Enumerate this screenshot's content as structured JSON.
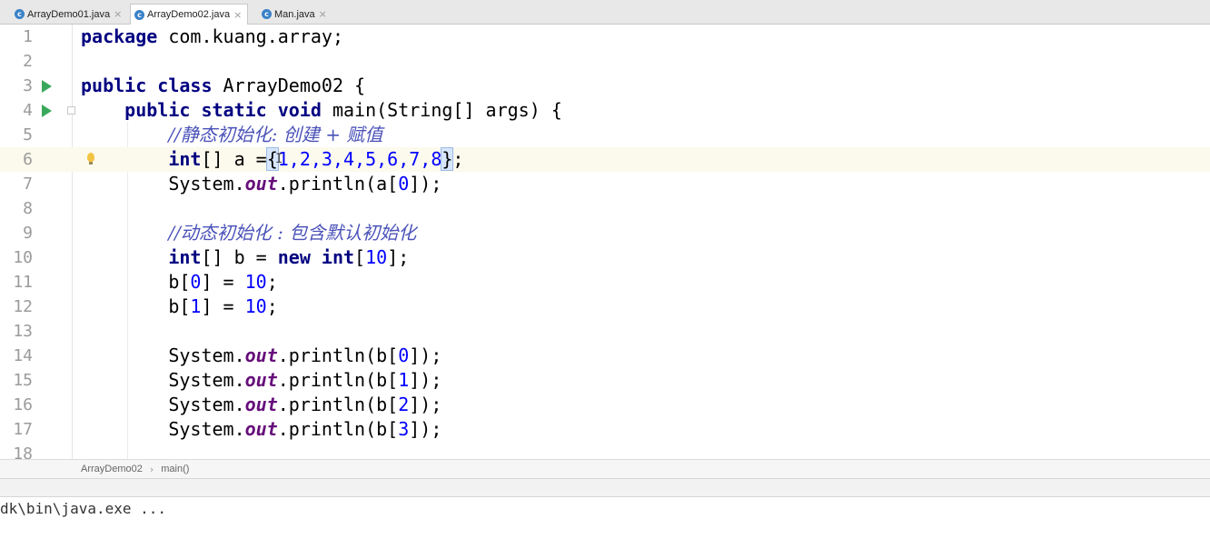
{
  "tabs": [
    {
      "label": "ArrayDemo01.java",
      "icon": "java-class-icon",
      "active": false
    },
    {
      "label": "ArrayDemo02.java",
      "icon": "java-class-icon",
      "active": true
    },
    {
      "label": "Man.java",
      "icon": "java-class-icon",
      "active": false
    }
  ],
  "editor": {
    "line_numbers": [
      "1",
      "2",
      "3",
      "4",
      "5",
      "6",
      "7",
      "8",
      "9",
      "10",
      "11",
      "12",
      "13",
      "14",
      "15",
      "16",
      "17",
      "18"
    ],
    "caret_line": "6",
    "code": {
      "l1_kw": "package",
      "l1_rest": " com.kuang.array;",
      "l3_kw1": "public",
      "l3_kw2": "class",
      "l3_rest": " ArrayDemo02 {",
      "l4_kw1": "public",
      "l4_kw2": "static",
      "l4_kw3": "void",
      "l4_rest": " main(String[] args) {",
      "l5_comment": "//静态初始化: 创建 + 赋值",
      "l6_kw": "int",
      "l6_a": "[] a =",
      "l6_open": "{",
      "l6_values": "1,2,3,4,5,6,7,8",
      "l6_close": "}",
      "l6_end": ";",
      "l7_sys": "System.",
      "l7_out": "out",
      "l7_rest": ".println(a[",
      "l7_idx": "0",
      "l7_end": "]);",
      "l9_comment": "//动态初始化 : 包含默认初始化",
      "l10_kw": "int",
      "l10_a": "[] b = ",
      "l10_new": "new",
      "l10_sp": " ",
      "l10_kw2": "int",
      "l10_b": "[",
      "l10_num": "10",
      "l10_c": "];",
      "l11_a": "b[",
      "l11_idx": "0",
      "l11_b": "] = ",
      "l11_val": "10",
      "l11_c": ";",
      "l12_a": "b[",
      "l12_idx": "1",
      "l12_b": "] = ",
      "l12_val": "10",
      "l12_c": ";",
      "l14_idx": "0",
      "l15_idx": "1",
      "l16_idx": "2",
      "l17_idx": "3",
      "print_sys": "System.",
      "print_out": "out",
      "print_rest": ".println(b[",
      "print_end": "]);"
    }
  },
  "breadcrumb": {
    "class_name": "ArrayDemo02",
    "separator": "›",
    "method": "main()"
  },
  "console": {
    "text": "dk\\bin\\java.exe ..."
  },
  "colors": {
    "keyword": "#000080",
    "number": "#0000ff",
    "static_field": "#660e7a",
    "comment": "#4a52b8",
    "caret_line": "#fcfaed"
  }
}
